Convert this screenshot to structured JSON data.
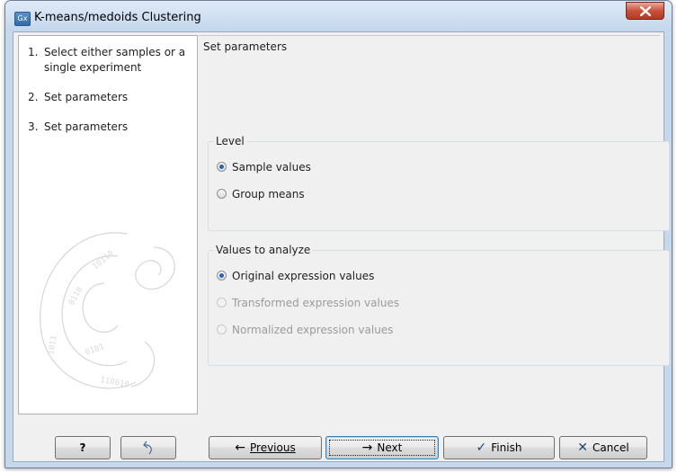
{
  "window": {
    "title": "K-means/medoids Clustering",
    "app_icon_text": "Gx",
    "close_icon": "close-icon"
  },
  "sidebar": {
    "steps": [
      {
        "number": "1.",
        "label": "Select either samples or a single experiment"
      },
      {
        "number": "2.",
        "label": "Set parameters"
      },
      {
        "number": "3.",
        "label": "Set parameters"
      }
    ]
  },
  "main": {
    "heading": "Set parameters",
    "level_group": {
      "title": "Level",
      "options": [
        {
          "label": "Sample values",
          "checked": true,
          "enabled": true
        },
        {
          "label": "Group means",
          "checked": false,
          "enabled": true
        }
      ]
    },
    "values_group": {
      "title": "Values to analyze",
      "options": [
        {
          "label": "Original expression values",
          "checked": true,
          "enabled": true
        },
        {
          "label": "Transformed expression values",
          "checked": false,
          "enabled": false
        },
        {
          "label": "Normalized expression values",
          "checked": false,
          "enabled": false
        }
      ]
    }
  },
  "buttons": {
    "help": "?",
    "reset_icon": "reset-icon",
    "previous": "Previous",
    "next": "Next",
    "finish": "Finish",
    "cancel": "Cancel"
  },
  "colors": {
    "accent": "#2a62b4",
    "title_bar": "#c6d8ec",
    "close_button": "#c9523b"
  }
}
